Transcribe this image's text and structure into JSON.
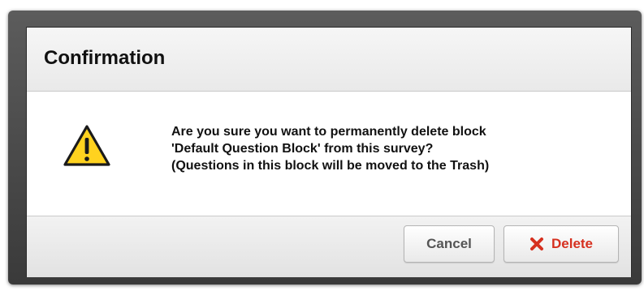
{
  "dialog": {
    "title": "Confirmation",
    "message_lines": [
      "Are you sure you want to permanently delete block",
      "'Default Question Block' from this survey?",
      "(Questions in this block will be moved to the Trash)"
    ],
    "icon": "warning-icon",
    "buttons": {
      "cancel_label": "Cancel",
      "delete_label": "Delete",
      "delete_icon": "x-icon"
    }
  },
  "colors": {
    "warning_yellow": "#ffd21f",
    "delete_red": "#d6301f"
  }
}
